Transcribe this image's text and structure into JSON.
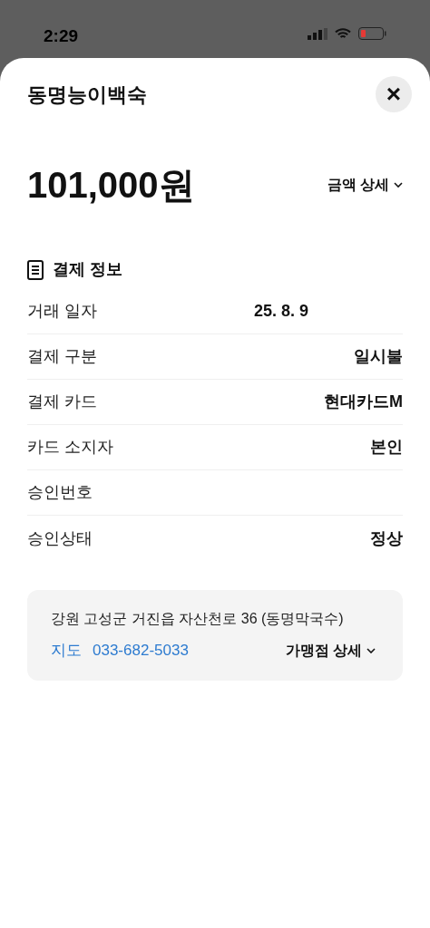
{
  "status_bar": {
    "time": "2:29"
  },
  "sheet": {
    "title": "동명능이백숙",
    "close": "×"
  },
  "amount": {
    "value": "101,000원",
    "detail_link": "금액 상세"
  },
  "section": {
    "title": "결제 정보"
  },
  "rows": [
    {
      "kind": "date",
      "label": "거래 일자",
      "value": "25. 8. 9"
    },
    {
      "kind": "plain",
      "label": "결제 구분",
      "value": "일시불"
    },
    {
      "kind": "plain",
      "label": "결제 카드",
      "value": "현대카드M"
    },
    {
      "kind": "plain",
      "label": "카드 소지자",
      "value": "본인"
    },
    {
      "kind": "empty",
      "label": "승인번호"
    },
    {
      "kind": "plain",
      "label": "승인상태",
      "value": "정상"
    }
  ],
  "merchant": {
    "address": "강원 고성군 거진읍 자산천로 36 (동명막국수)",
    "map_link": "지도",
    "phone": "033-682-5033",
    "detail_link": "가맹점 상세"
  }
}
